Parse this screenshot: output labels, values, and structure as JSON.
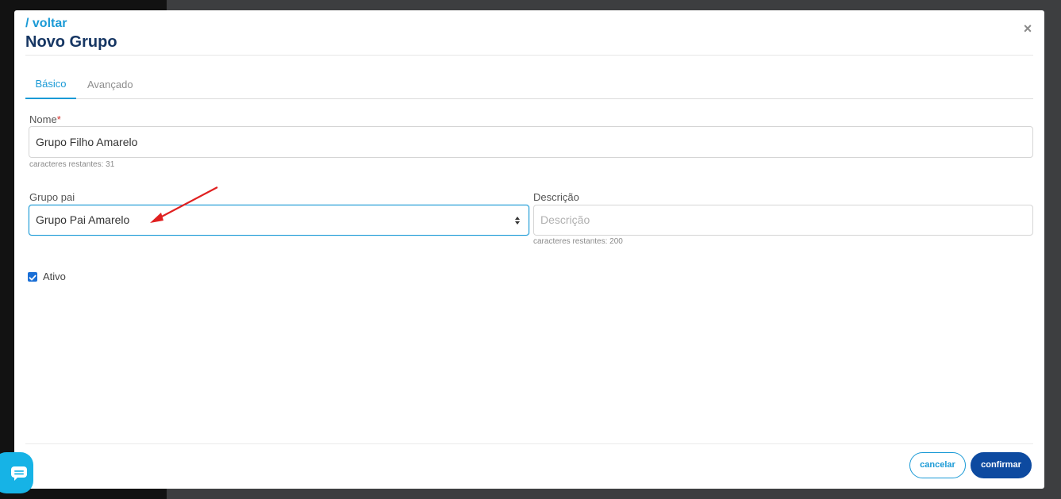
{
  "header": {
    "back_label": "/ voltar",
    "title": "Novo Grupo",
    "close_symbol": "×"
  },
  "tabs": [
    {
      "label": "Básico",
      "active": true
    },
    {
      "label": "Avançado",
      "active": false
    }
  ],
  "form": {
    "nome": {
      "label": "Nome",
      "required_mark": "*",
      "value": "Grupo Filho Amarelo",
      "hint": "caracteres restantes: 31"
    },
    "grupo_pai": {
      "label": "Grupo pai",
      "selected": "Grupo Pai Amarelo"
    },
    "descricao": {
      "label": "Descrição",
      "placeholder": "Descrição",
      "value": "",
      "hint": "caracteres restantes: 200"
    },
    "ativo": {
      "label": "Ativo",
      "checked": true
    }
  },
  "footer": {
    "cancel_label": "cancelar",
    "confirm_label": "confirmar"
  },
  "colors": {
    "accent": "#1a9ad6",
    "title": "#163663",
    "confirm": "#0d4aa0",
    "annotation_arrow": "#e02020",
    "chat": "#16b3e6"
  },
  "icons": {
    "close": "close-icon",
    "select_caret": "sort-caret-icon",
    "checkbox": "check-icon",
    "chat": "chat-icon",
    "annotation": "red-arrow-annotation"
  }
}
